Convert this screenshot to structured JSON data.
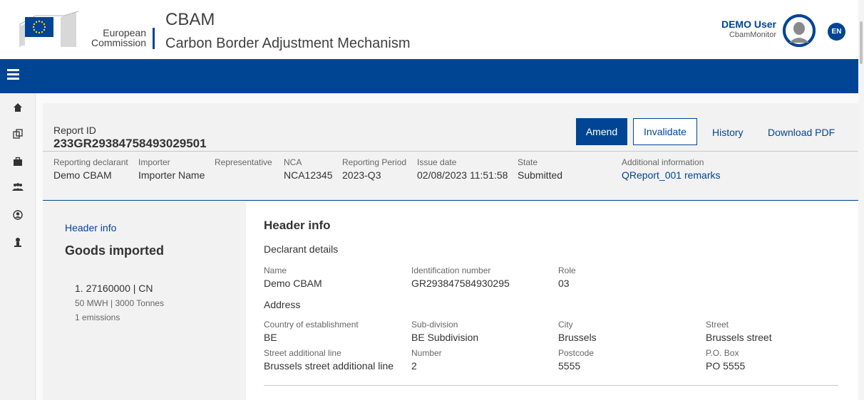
{
  "header": {
    "org_line1": "European",
    "org_line2": "Commission",
    "app_short": "CBAM",
    "app_long": "Carbon Border Adjustment Mechanism",
    "user_name": "DEMO User",
    "user_role": "CbamMonitor",
    "language": "EN"
  },
  "sidebar": {
    "icons": [
      "home-icon",
      "copy-icon",
      "briefcase-icon",
      "users-icon",
      "user-circle-icon",
      "person-icon"
    ]
  },
  "report": {
    "id_label": "Report ID",
    "id_value": "233GR29384758493029501",
    "amend_label": "Amend",
    "invalidate_label": "Invalidate",
    "history_label": "History",
    "download_label": "Download PDF",
    "meta": {
      "declarant_label": "Reporting declarant",
      "declarant_value": "Demo CBAM",
      "importer_label": "Importer",
      "importer_value": "Importer Name",
      "representative_label": "Representative",
      "nca_label": "NCA",
      "nca_value": "NCA12345",
      "period_label": "Reporting Period",
      "period_value": "2023-Q3",
      "issue_label": "Issue date",
      "issue_value": "02/08/2023 11:51:58",
      "state_label": "State",
      "state_value": "Submitted",
      "additional_label": "Additional information",
      "additional_value": "QReport_001 remarks"
    }
  },
  "left_nav": {
    "header_link": "Header info",
    "goods_title": "Goods imported",
    "item_title": "1. 27160000 | CN",
    "item_qty": "50 MWH | 3000 Tonnes",
    "item_emissions": "1 emissions"
  },
  "main": {
    "title": "Header info",
    "declarant_section": "Declarant details",
    "name_label": "Name",
    "name_value": "Demo CBAM",
    "idnum_label": "Identification number",
    "idnum_value": "GR293847584930295",
    "role_label": "Role",
    "role_value": "03",
    "address_section": "Address",
    "country_label": "Country of establishment",
    "country_value": "BE",
    "subdiv_label": "Sub-division",
    "subdiv_value": "BE Subdivision",
    "city_label": "City",
    "city_value": "Brussels",
    "street_label": "Street",
    "street_value": "Brussels street",
    "street_add_label": "Street additional line",
    "street_add_value": "Brussels street additional line",
    "number_label": "Number",
    "number_value": "2",
    "postcode_label": "Postcode",
    "postcode_value": "5555",
    "pobox_label": "P.O. Box",
    "pobox_value": "PO 5555"
  },
  "colors": {
    "brand_blue": "#004494",
    "panel_grey": "#f2f2f2"
  }
}
